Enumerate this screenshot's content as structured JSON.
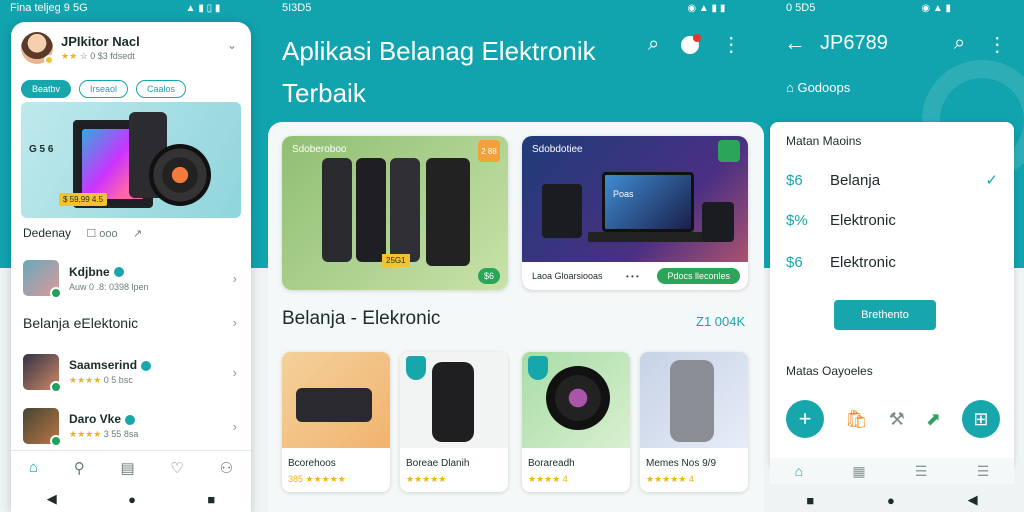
{
  "status": {
    "left": {
      "text": "Fina teljeg 9 5G",
      "icons": "▲ ▮ ▯ ▮"
    },
    "middle": {
      "text": "5I3D5",
      "icons": "◉ ▲ ▮ ▮"
    },
    "right": {
      "text": "0 5D5",
      "icons": "◉ ▲ ▮"
    }
  },
  "left_phone": {
    "profile": {
      "name": "JPIkitor Nacl",
      "stars": "★★",
      "sub": "☆ 0 $3 fdsedt"
    },
    "chips": [
      "Beatbv",
      "Irseaol",
      "Caalos"
    ],
    "promo": {
      "tag": "G 5 6",
      "price": "$ 59,99 4.5"
    },
    "row_title": "Dedenay",
    "row_icons": [
      "☐ ooo",
      "↗"
    ],
    "contact1": {
      "name": "Kdjbne",
      "meta_stars": "",
      "meta": "Auw 0 .8: 0398 lpen"
    },
    "section": "Belanja eElektonic",
    "contact2": {
      "name": "Saamserind",
      "meta_stars": "★★★★",
      "meta": "0 5 bsc"
    },
    "contact3": {
      "name": "Daro Vke",
      "meta_stars": "★★★★",
      "meta": "3 55 8sa"
    },
    "tabs": [
      "⌂",
      "⚲",
      "▤",
      "♡",
      "⚇"
    ],
    "nav": [
      "◀",
      "●",
      "■"
    ]
  },
  "middle": {
    "title": "Aplikasi Belanag Elektronik Terbaik",
    "actions": {
      "search": "⌕",
      "more": "⋮"
    },
    "card1": {
      "label": "Sdoberoboo",
      "corner": "2 88",
      "price": "25G1",
      "cta": "$6"
    },
    "card2": {
      "label": "Sdobdotiee",
      "screen": "Poas",
      "foot": "Laoa Gloarsiooas",
      "dots": "• • •",
      "cta": "Pdocs lleconles"
    },
    "section": "Belanja - Elekronic",
    "section_link": "Z1 004K",
    "products": [
      {
        "name": "Bcorehoos",
        "stars": "385 ★★★★★"
      },
      {
        "name": "Boreae Dlanih",
        "stars": "★★★★★"
      },
      {
        "name": "Borareadh",
        "stars": "★★★★ 4"
      },
      {
        "name": "Memes Nos 9/9",
        "stars": "★★★★★ 4"
      }
    ]
  },
  "right": {
    "title": "JP6789",
    "back": "←",
    "search": "⌕",
    "more": "⋮",
    "sub": "⌂ Godoops",
    "panel_head": "Matan Maoins",
    "items": [
      {
        "cur": "$6",
        "label": "Belanja",
        "checked": "✓"
      },
      {
        "cur": "$%",
        "label": "Elektronic",
        "checked": ""
      },
      {
        "cur": "$6",
        "label": "Elektronic",
        "checked": ""
      }
    ],
    "button": "Brethento",
    "panel_head2": "Matas Oayoeles",
    "actions": [
      "+",
      "🛍",
      "⚒",
      "⬈",
      "⊞"
    ],
    "tabs": [
      "⌂",
      "▦",
      "☰",
      "☰"
    ],
    "nav": [
      "■",
      "●",
      "◀"
    ]
  },
  "colors": {
    "accent": "#11a3ae",
    "badge_green": "#2aa55a",
    "star": "#f2b01e"
  }
}
